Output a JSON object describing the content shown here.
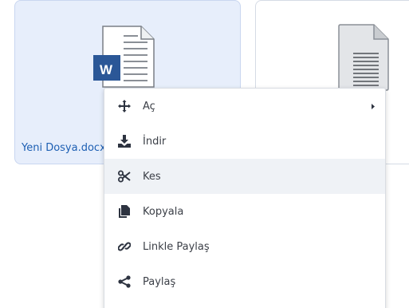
{
  "files": [
    {
      "name": "Yeni Dosya.docx",
      "badge": "W",
      "selected": true
    },
    {
      "name": "",
      "selected": false
    }
  ],
  "context_menu": {
    "items": [
      {
        "label": "Aç",
        "icon": "move-arrows-icon",
        "has_submenu": true
      },
      {
        "label": "İndir",
        "icon": "download-icon"
      },
      {
        "label": "Kes",
        "icon": "scissors-icon"
      },
      {
        "label": "Kopyala",
        "icon": "copy-icon"
      },
      {
        "label": "Linkle Paylaş",
        "icon": "link-icon"
      },
      {
        "label": "Paylaş",
        "icon": "share-icon"
      }
    ],
    "hovered_index": 2
  },
  "colors": {
    "accent": "#1d5fb3",
    "word_blue": "#2b5797",
    "selected_card_bg": "#e7eefb",
    "hover_bg": "#eff2f6"
  }
}
